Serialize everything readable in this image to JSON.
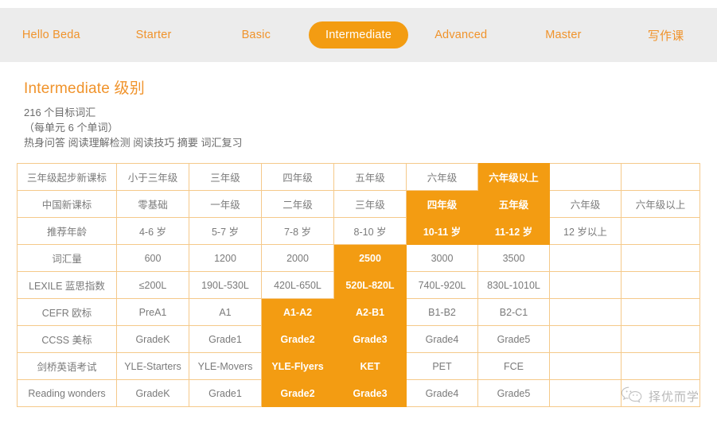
{
  "nav": {
    "items": [
      {
        "label": "Hello Beda",
        "active": false,
        "lang": "en"
      },
      {
        "label": "Starter",
        "active": false,
        "lang": "en"
      },
      {
        "label": "Basic",
        "active": false,
        "lang": "en"
      },
      {
        "label": "Intermediate",
        "active": true,
        "lang": "en"
      },
      {
        "label": "Advanced",
        "active": false,
        "lang": "en"
      },
      {
        "label": "Master",
        "active": false,
        "lang": "en"
      },
      {
        "label": "写作课",
        "active": false,
        "lang": "cn"
      }
    ],
    "background_color": "#ececec",
    "text_color": "#f0932b",
    "active_pill_color": "#f39c12",
    "active_pill_text_color": "#ffffff"
  },
  "intro": {
    "title": "Intermediate 级别",
    "title_color": "#f0932b",
    "lines": [
      "216 个目标词汇",
      "（每单元 6 个单词）",
      "热身问答 阅读理解检测 阅读技巧 摘要 词汇复习"
    ]
  },
  "table": {
    "border_color": "#f5c98a",
    "highlight_color": "#f39c12",
    "text_color": "#7a7a7a",
    "columns": 9,
    "rows": [
      {
        "label": "三年级起步新课标",
        "cells": [
          "小于三年级",
          "三年级",
          "四年级",
          "五年级",
          "六年级",
          "六年级以上",
          "",
          ""
        ],
        "highlight": [
          false,
          false,
          false,
          false,
          false,
          true,
          false,
          false
        ]
      },
      {
        "label": "中国新课标",
        "cells": [
          "零基础",
          "一年级",
          "二年级",
          "三年级",
          "四年级",
          "五年级",
          "六年级",
          "六年级以上"
        ],
        "highlight": [
          false,
          false,
          false,
          false,
          true,
          true,
          false,
          false
        ]
      },
      {
        "label": "推荐年龄",
        "cells": [
          "4-6 岁",
          "5-7 岁",
          "7-8 岁",
          "8-10 岁",
          "10-11 岁",
          "11-12 岁",
          "12 岁以上",
          ""
        ],
        "highlight": [
          false,
          false,
          false,
          false,
          true,
          true,
          false,
          false
        ]
      },
      {
        "label": "词汇量",
        "cells": [
          "600",
          "1200",
          "2000",
          "2500",
          "3000",
          "3500",
          "",
          ""
        ],
        "highlight": [
          false,
          false,
          false,
          true,
          false,
          false,
          false,
          false
        ]
      },
      {
        "label": "LEXILE 蓝思指数",
        "cells": [
          "≤200L",
          "190L-530L",
          "420L-650L",
          "520L-820L",
          "740L-920L",
          "830L-1010L",
          "",
          ""
        ],
        "highlight": [
          false,
          false,
          false,
          true,
          false,
          false,
          false,
          false
        ]
      },
      {
        "label": "CEFR 欧标",
        "cells": [
          "PreA1",
          "A1",
          "A1-A2",
          "A2-B1",
          "B1-B2",
          "B2-C1",
          "",
          ""
        ],
        "highlight": [
          false,
          false,
          true,
          true,
          false,
          false,
          false,
          false
        ]
      },
      {
        "label": "CCSS 美标",
        "cells": [
          "GradeK",
          "Grade1",
          "Grade2",
          "Grade3",
          "Grade4",
          "Grade5",
          "",
          ""
        ],
        "highlight": [
          false,
          false,
          true,
          true,
          false,
          false,
          false,
          false
        ]
      },
      {
        "label": "剑桥英语考试",
        "cells": [
          "YLE-Starters",
          "YLE-Movers",
          "YLE-Flyers",
          "KET",
          "PET",
          "FCE",
          "",
          ""
        ],
        "highlight": [
          false,
          false,
          true,
          true,
          false,
          false,
          false,
          false
        ]
      },
      {
        "label": "Reading wonders",
        "cells": [
          "GradeK",
          "Grade1",
          "Grade2",
          "Grade3",
          "Grade4",
          "Grade5",
          "",
          ""
        ],
        "highlight": [
          false,
          false,
          true,
          true,
          false,
          false,
          false,
          false
        ]
      }
    ]
  },
  "watermark": {
    "text": "择优而学",
    "icon": "wechat-icon",
    "color": "#8d8d8d"
  }
}
